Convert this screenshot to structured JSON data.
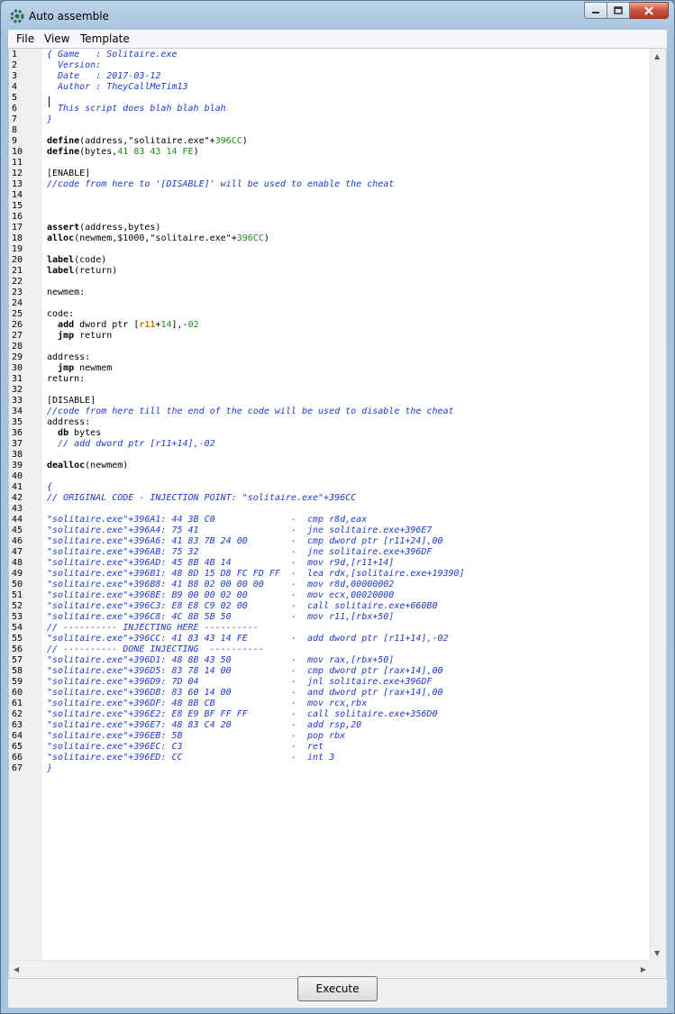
{
  "window": {
    "title": "Auto assemble",
    "app_icon": "cheat-engine-icon"
  },
  "menu": [
    "File",
    "View",
    "Template"
  ],
  "editor": {
    "lines": [
      [
        {
          "t": "{ Game   : Solitaire.exe",
          "c": "cm"
        }
      ],
      [
        {
          "t": "  Version: ",
          "c": "cm"
        }
      ],
      [
        {
          "t": "  Date   : 2017-03-12",
          "c": "cm"
        }
      ],
      [
        {
          "t": "  Author : TheyCallMeTim13",
          "c": "cm"
        }
      ],
      [],
      [
        {
          "t": "  This script does blah blah blah",
          "c": "cm"
        }
      ],
      [
        {
          "t": "}",
          "c": "cm"
        }
      ],
      [],
      [
        {
          "t": "define",
          "c": "kw"
        },
        {
          "t": "(address,\"solitaire.exe\"+",
          "c": ""
        },
        {
          "t": "396CC",
          "c": "num"
        },
        {
          "t": ")",
          "c": ""
        }
      ],
      [
        {
          "t": "define",
          "c": "kw"
        },
        {
          "t": "(bytes,",
          "c": ""
        },
        {
          "t": "41 83 43 14 FE",
          "c": "num"
        },
        {
          "t": ")",
          "c": ""
        }
      ],
      [],
      [
        {
          "t": "[ENABLE]",
          "c": ""
        }
      ],
      [
        {
          "t": "//code from here to '[DISABLE]' will be used to enable the cheat",
          "c": "cm"
        }
      ],
      [],
      [],
      [],
      [
        {
          "t": "assert",
          "c": "kw"
        },
        {
          "t": "(address,bytes)",
          "c": ""
        }
      ],
      [
        {
          "t": "alloc",
          "c": "kw"
        },
        {
          "t": "(newmem,$1000,\"solitaire.exe\"+",
          "c": ""
        },
        {
          "t": "396CC",
          "c": "num"
        },
        {
          "t": ")",
          "c": ""
        }
      ],
      [],
      [
        {
          "t": "label",
          "c": "kw"
        },
        {
          "t": "(code)",
          "c": ""
        }
      ],
      [
        {
          "t": "label",
          "c": "kw"
        },
        {
          "t": "(return)",
          "c": ""
        }
      ],
      [],
      [
        {
          "t": "newmem:",
          "c": ""
        }
      ],
      [],
      [
        {
          "t": "code:",
          "c": ""
        }
      ],
      [
        {
          "t": "  ",
          "c": ""
        },
        {
          "t": "add",
          "c": "kw"
        },
        {
          "t": " dword ptr [",
          "c": ""
        },
        {
          "t": "r11",
          "c": "reg"
        },
        {
          "t": "+",
          "c": ""
        },
        {
          "t": "14",
          "c": "num"
        },
        {
          "t": "],-",
          "c": ""
        },
        {
          "t": "02",
          "c": "num"
        }
      ],
      [
        {
          "t": "  ",
          "c": ""
        },
        {
          "t": "jmp",
          "c": "kw"
        },
        {
          "t": " return",
          "c": ""
        }
      ],
      [],
      [
        {
          "t": "address:",
          "c": ""
        }
      ],
      [
        {
          "t": "  ",
          "c": ""
        },
        {
          "t": "jmp",
          "c": "kw"
        },
        {
          "t": " newmem",
          "c": ""
        }
      ],
      [
        {
          "t": "return:",
          "c": ""
        }
      ],
      [],
      [
        {
          "t": "[DISABLE]",
          "c": ""
        }
      ],
      [
        {
          "t": "//code from here till the end of the code will be used to disable the cheat",
          "c": "cm"
        }
      ],
      [
        {
          "t": "address:",
          "c": ""
        }
      ],
      [
        {
          "t": "  ",
          "c": ""
        },
        {
          "t": "db",
          "c": "kw"
        },
        {
          "t": " bytes",
          "c": ""
        }
      ],
      [
        {
          "t": "  // add dword ptr [r11+14],-02",
          "c": "cm"
        }
      ],
      [],
      [
        {
          "t": "dealloc",
          "c": "kw"
        },
        {
          "t": "(newmem)",
          "c": ""
        }
      ],
      [],
      [
        {
          "t": "{",
          "c": "cm"
        }
      ],
      [
        {
          "t": "// ORIGINAL CODE - INJECTION POINT: \"solitaire.exe\"+396CC",
          "c": "cm"
        }
      ],
      [],
      [
        {
          "t": "\"solitaire.exe\"+396A1: 44 3B C0              -  cmp r8d,eax",
          "c": "cm"
        }
      ],
      [
        {
          "t": "\"solitaire.exe\"+396A4: 75 41                 -  jne solitaire.exe+396E7",
          "c": "cm"
        }
      ],
      [
        {
          "t": "\"solitaire.exe\"+396A6: 41 83 7B 24 00        -  cmp dword ptr [r11+24],00",
          "c": "cm"
        }
      ],
      [
        {
          "t": "\"solitaire.exe\"+396AB: 75 32                 -  jne solitaire.exe+396DF",
          "c": "cm"
        }
      ],
      [
        {
          "t": "\"solitaire.exe\"+396AD: 45 8B 4B 14           -  mov r9d,[r11+14]",
          "c": "cm"
        }
      ],
      [
        {
          "t": "\"solitaire.exe\"+396B1: 48 8D 15 D8 FC FD FF  -  lea rdx,[solitaire.exe+19390]",
          "c": "cm"
        }
      ],
      [
        {
          "t": "\"solitaire.exe\"+396B8: 41 B8 02 00 00 00     -  mov r8d,00000002",
          "c": "cm"
        }
      ],
      [
        {
          "t": "\"solitaire.exe\"+396BE: B9 00 00 02 00        -  mov ecx,00020000",
          "c": "cm"
        }
      ],
      [
        {
          "t": "\"solitaire.exe\"+396C3: E8 E8 C9 02 00        -  call solitaire.exe+660B0",
          "c": "cm"
        }
      ],
      [
        {
          "t": "\"solitaire.exe\"+396C8: 4C 8B 5B 50           -  mov r11,[rbx+50]",
          "c": "cm"
        }
      ],
      [
        {
          "t": "// ---------- INJECTING HERE ----------",
          "c": "cm"
        }
      ],
      [
        {
          "t": "\"solitaire.exe\"+396CC: 41 83 43 14 FE        -  add dword ptr [r11+14],-02",
          "c": "cm"
        }
      ],
      [
        {
          "t": "// ---------- DONE INJECTING  ----------",
          "c": "cm"
        }
      ],
      [
        {
          "t": "\"solitaire.exe\"+396D1: 48 8B 43 50           -  mov rax,[rbx+50]",
          "c": "cm"
        }
      ],
      [
        {
          "t": "\"solitaire.exe\"+396D5: 83 78 14 00           -  cmp dword ptr [rax+14],00",
          "c": "cm"
        }
      ],
      [
        {
          "t": "\"solitaire.exe\"+396D9: 7D 04                 -  jnl solitaire.exe+396DF",
          "c": "cm"
        }
      ],
      [
        {
          "t": "\"solitaire.exe\"+396DB: 83 60 14 00           -  and dword ptr [rax+14],00",
          "c": "cm"
        }
      ],
      [
        {
          "t": "\"solitaire.exe\"+396DF: 48 8B CB              -  mov rcx,rbx",
          "c": "cm"
        }
      ],
      [
        {
          "t": "\"solitaire.exe\"+396E2: E8 E9 BF FF FF        -  call solitaire.exe+356D0",
          "c": "cm"
        }
      ],
      [
        {
          "t": "\"solitaire.exe\"+396E7: 48 83 C4 20           -  add rsp,20",
          "c": "cm"
        }
      ],
      [
        {
          "t": "\"solitaire.exe\"+396EB: 5B                    -  pop rbx",
          "c": "cm"
        }
      ],
      [
        {
          "t": "\"solitaire.exe\"+396EC: C3                    -  ret",
          "c": "cm"
        }
      ],
      [
        {
          "t": "\"solitaire.exe\"+396ED: CC                    -  int 3",
          "c": "cm"
        }
      ],
      [
        {
          "t": "}",
          "c": "cm"
        }
      ]
    ]
  },
  "buttons": {
    "execute": "Execute"
  },
  "colors": {
    "comment": "#1e3ad0",
    "number": "#1b8a1b",
    "register": "#c87a00"
  }
}
